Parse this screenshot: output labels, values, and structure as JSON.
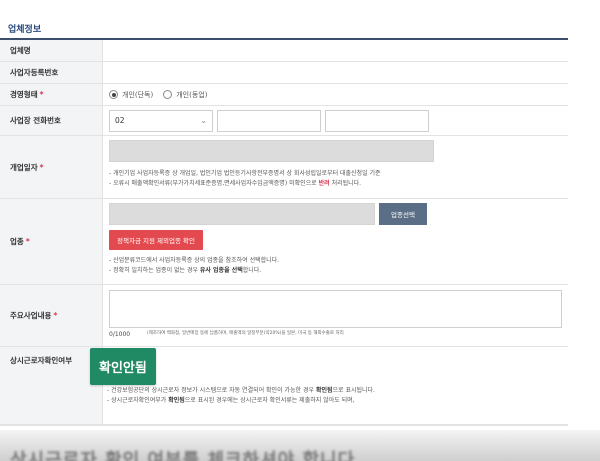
{
  "section": {
    "title": "업체정보"
  },
  "rows": {
    "company_name": {
      "label": "업체명"
    },
    "business_number": {
      "label": "사업자등록번호"
    },
    "business_type": {
      "label": "경영형태",
      "required": "*",
      "options": [
        "개인(단독)",
        "개인(동업)"
      ],
      "selected": "개인(단독)"
    },
    "phone": {
      "label": "사업장 전화번호",
      "area_code": "02",
      "chevron": "⌄"
    },
    "open_date": {
      "label": "개업일자",
      "required": "*",
      "notes": [
        "- 개인기업 사업자등록증 상 개업일, 법인기업 법인등기사항전부증명서 상 회사성립일로부터 대출신청일 기준",
        "- 오류시 매출액확인서류(부가가치세표준증명,면세사업자수입금액증명) 미확인으로"
      ],
      "note2_red": "반려",
      "note2_tail": " 처리됩니다."
    },
    "industry": {
      "label": "업종",
      "required": "*",
      "select_button": "업종선택",
      "excluded_button": "정책자금 지원 제외업종 확인",
      "notes": [
        "- 산업분류코드에서 사업자등록증 상의 업종을 참조하여 선택합니다.",
        "- 정확히 일치하는 업종이 없는 경우"
      ],
      "note2_bold": "유사 업종을 선택",
      "note2_tail": "합니다."
    },
    "main_business": {
      "label": "주요사업내용",
      "required": "*",
      "counter": "0/1000",
      "tiny_note": "(제조하여 백화점, 일반매장 등에 납품하며, 매출액의 일정부분(약20%)을 일본, 미국 등 해외수출로 처리"
    },
    "regular_employees": {
      "label": "상시근로자확인여부",
      "badge": "확인안됨",
      "notes": [
        "- 건강보험공단의 상시근로자 정보가 시스템으로 자동 연결되어 확인이 가능한 경우",
        "- 상시근로자확인여부가"
      ],
      "note1_bold": "확인됨",
      "note1_tail": "으로 표시됩니다.",
      "note2_bold": "확인됨",
      "note2_tail": "으로 표시된 경우에는 상시근로자 확인서류는 제출하지 않아도 되며,"
    }
  },
  "bottom_caption": "상시근로자 확인 여부를 체크하셔야 합니다"
}
